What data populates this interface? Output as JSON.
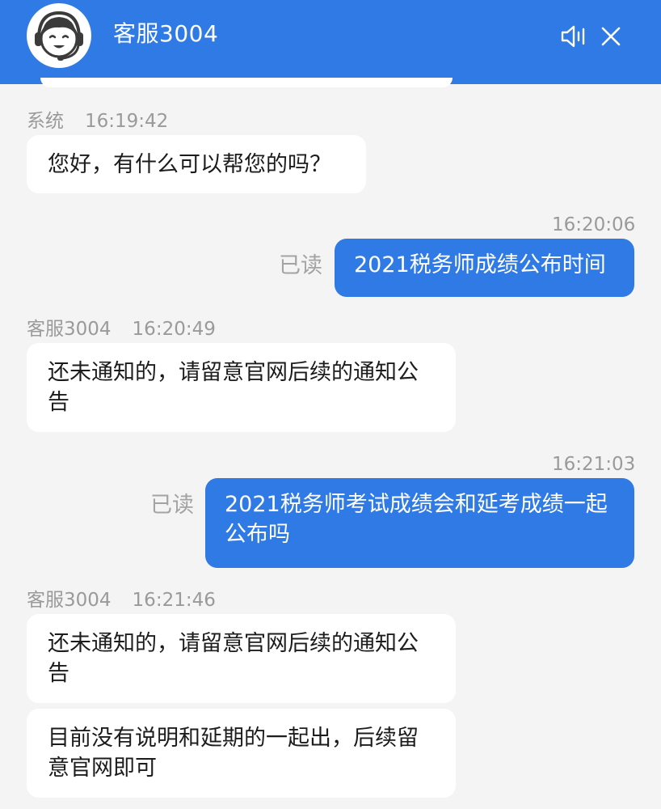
{
  "header": {
    "agent_name": "客服3004",
    "avatar_icon": "headset-agent-avatar",
    "speaker_icon": "speaker-icon",
    "close_icon": "close-icon",
    "accent_color": "#2f7ae5"
  },
  "messages": [
    {
      "direction": "incoming",
      "sender": "系统",
      "time": "16:19:42",
      "text": "您好，有什么可以帮您的吗？"
    },
    {
      "direction": "outgoing",
      "time": "16:20:06",
      "status": "已读",
      "text": "2021税务师成绩公布时间"
    },
    {
      "direction": "incoming",
      "sender": "客服3004",
      "time": "16:20:49",
      "text": "还未通知的，请留意官网后续的通知公告"
    },
    {
      "direction": "outgoing",
      "time": "16:21:03",
      "status": "已读",
      "text": "2021税务师考试成绩会和延考成绩一起公布吗"
    },
    {
      "direction": "incoming",
      "sender": "客服3004",
      "time": "16:21:46",
      "text": "还未通知的，请留意官网后续的通知公告"
    },
    {
      "direction": "incoming",
      "text": "目前没有说明和延期的一起出，后续留意官网即可"
    }
  ]
}
